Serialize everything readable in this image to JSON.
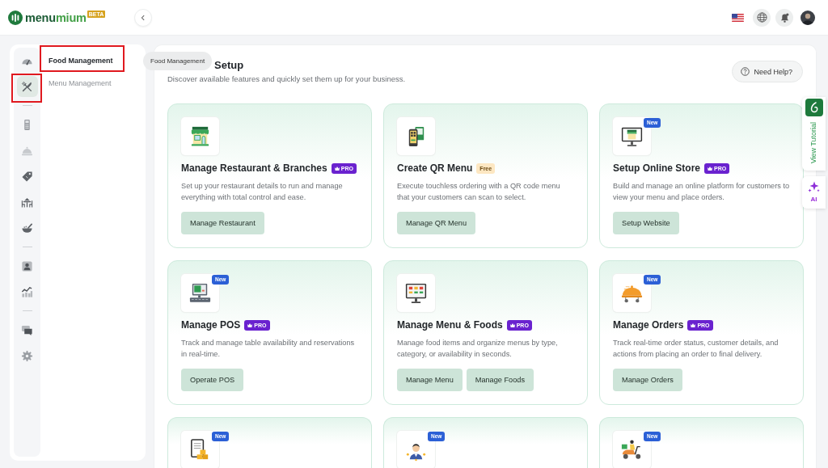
{
  "header": {
    "brand": {
      "name_parts": [
        "menu",
        "mium"
      ],
      "badge": "BETA"
    }
  },
  "sidebar": {
    "rail_groups": [
      {
        "items": [
          {
            "selected": false,
            "highlighted": false
          },
          {
            "selected": true,
            "highlighted": true
          }
        ]
      },
      {
        "items": [
          {
            "selected": false,
            "highlighted": false
          },
          {
            "selected": false,
            "highlighted": false
          },
          {
            "selected": false,
            "highlighted": false
          },
          {
            "selected": false,
            "highlighted": false
          },
          {
            "selected": false,
            "highlighted": false
          }
        ]
      },
      {
        "items": [
          {
            "selected": false,
            "highlighted": false
          },
          {
            "selected": false,
            "highlighted": false
          }
        ]
      },
      {
        "items": [
          {
            "selected": false,
            "highlighted": false
          },
          {
            "selected": false,
            "highlighted": false
          }
        ]
      }
    ],
    "submenu": [
      {
        "label": "Food Management",
        "selected": true,
        "highlighted": true
      },
      {
        "label": "Menu Management",
        "selected": false,
        "highlighted": false
      }
    ]
  },
  "tooltip": {
    "text": "Food Management"
  },
  "main": {
    "title": "Setup",
    "subtitle": "Discover available features and quickly set them up for your business.",
    "help_button": "Need Help?",
    "cards": [
      {
        "title": "Manage Restaurant & Branches",
        "badge": {
          "kind": "pro",
          "label": "PRO"
        },
        "description": "Set up your restaurant details to run and manage everything with total control and ease.",
        "buttons": [
          "Manage Restaurant"
        ]
      },
      {
        "title": "Create QR Menu",
        "badge": {
          "kind": "free",
          "label": "Free"
        },
        "description": "Execute touchless ordering with a QR code menu that your customers can scan to select.",
        "buttons": [
          "Manage QR Menu"
        ]
      },
      {
        "tag": "New",
        "title": "Setup Online Store",
        "badge": {
          "kind": "pro",
          "label": "PRO"
        },
        "description": "Build and manage an online platform for customers to view your menu and place orders.",
        "buttons": [
          "Setup Website"
        ]
      },
      {
        "tag": "New",
        "title": "Manage POS",
        "badge": {
          "kind": "pro",
          "label": "PRO"
        },
        "description": "Track and manage table availability and reservations in real-time.",
        "buttons": [
          "Operate POS"
        ]
      },
      {
        "title": "Manage Menu & Foods",
        "badge": {
          "kind": "pro",
          "label": "PRO"
        },
        "description": "Manage food items and organize menus by type, category, or availability in seconds.",
        "buttons": [
          "Manage Menu",
          "Manage Foods"
        ]
      },
      {
        "tag": "New",
        "title": "Manage Orders",
        "badge": {
          "kind": "pro",
          "label": "PRO"
        },
        "description": "Track real-time order status, customer details, and actions from placing an order to final delivery.",
        "buttons": [
          "Manage Orders"
        ]
      },
      {
        "tag": "New"
      },
      {
        "tag": "New"
      },
      {
        "tag": "New"
      }
    ]
  },
  "side_tabs": [
    {
      "kind": "tutorial",
      "label": "View Tutorial"
    },
    {
      "kind": "ai",
      "label": "AI"
    }
  ]
}
